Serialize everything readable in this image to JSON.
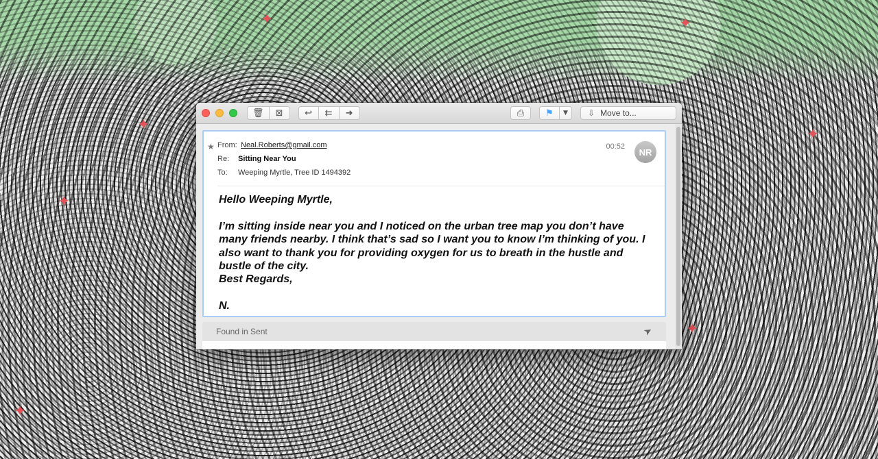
{
  "window": {
    "toolbar": {
      "icons": {
        "delete": "trash-icon",
        "archive": "archive-icon",
        "reply": "reply-icon",
        "reply_all": "reply-all-icon",
        "forward": "forward-icon",
        "print": "print-icon",
        "flag": "flag-icon",
        "flag_menu": "chevron-down-icon",
        "move": "move-to-icon"
      },
      "move_to_label": "Move to...",
      "flag_color": "#4aa3ff"
    },
    "message": {
      "from_label": "From:",
      "from_value": "Neal.Roberts@gmail.com",
      "subject_label": "Re:",
      "subject_value": "Sitting Near You",
      "to_label": "To:",
      "to_value": "Weeping Myrtle, Tree ID 1494392",
      "time": "00:52",
      "avatar_initials": "NR",
      "body": {
        "greeting": "Hello Weeping Myrtle,",
        "paragraph": "I’m sitting inside near you and I noticed on the urban tree map you don’t have many friends nearby. I think that’s sad so I want you to know I’m thinking of you. I also want to thank you for providing oxygen for us to breath in the hustle and bustle of the city.",
        "closing": "Best Regards,",
        "signature": "N."
      }
    },
    "footer": {
      "found_in": "Found in Sent",
      "send_icon": "send-icon"
    }
  },
  "colors": {
    "selection_border": "#a9cdf5",
    "bird": "#e4525a"
  }
}
